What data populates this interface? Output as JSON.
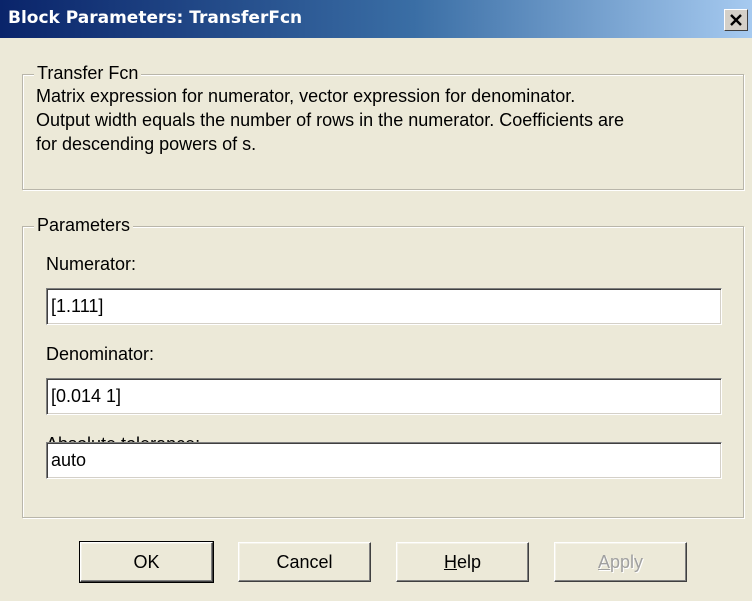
{
  "window": {
    "title": "Block Parameters: TransferFcn"
  },
  "transfer_group": {
    "legend": "Transfer Fcn",
    "description_lines": [
      "Matrix expression for numerator, vector expression for denominator.",
      "Output width equals the number of rows in the numerator.  Coefficients are",
      "for descending powers of s."
    ]
  },
  "parameters_group": {
    "legend": "Parameters",
    "numerator": {
      "label": "Numerator:",
      "value": "[1.111]"
    },
    "denominator": {
      "label": "Denominator:",
      "value": "[0.014 1]"
    },
    "absolute_tolerance": {
      "label": "Absolute tolerance:",
      "value": "auto"
    }
  },
  "buttons": {
    "ok": "OK",
    "cancel": "Cancel",
    "help": {
      "accel": "H",
      "rest": "elp"
    },
    "apply": {
      "accel": "A",
      "rest": "pply"
    }
  },
  "icons": {
    "close": "close-x-icon"
  }
}
